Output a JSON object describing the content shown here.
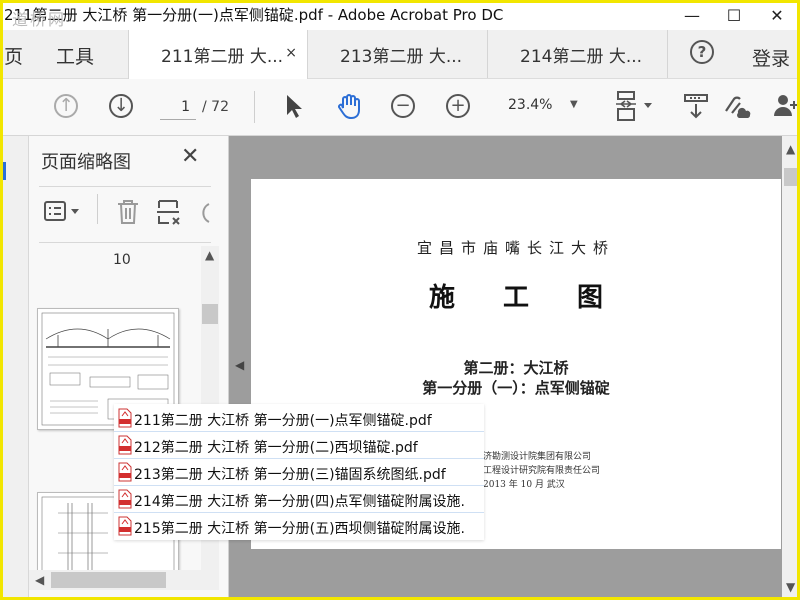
{
  "window": {
    "title": "211第二册 大江桥 第一分册(一)点军侧锚碇.pdf - Adobe Acrobat Pro DC",
    "watermark": "道桥网",
    "minimize": "—",
    "maximize": "☐",
    "close": "✕"
  },
  "menu": {
    "home": "页",
    "tools": "工具",
    "login": "登录",
    "help": "?"
  },
  "tabs": [
    {
      "label": "211第二册 大...",
      "active": true,
      "close": "×"
    },
    {
      "label": "213第二册 大...",
      "active": false
    },
    {
      "label": "214第二册 大...",
      "active": false
    }
  ],
  "toolbar": {
    "current_page": "1",
    "total_pages": "/ 72",
    "zoom": "23.4%"
  },
  "thumbnails": {
    "title": "页面缩略图",
    "close": "✕",
    "page_label": "10"
  },
  "document": {
    "subtitle": "宜昌市庙嘴长江大桥",
    "title": "施工图",
    "volume": "第二册：大江桥",
    "part": "第一分册（一）：点军侧锚碇",
    "org1": "济勘测设计院集团有限公司",
    "org2": "工程设计研究院有限责任公司",
    "date": "2013 年 10 月    武汉"
  },
  "files": [
    "211第二册 大江桥 第一分册(一)点军侧锚碇.pdf",
    "212第二册 大江桥 第一分册(二)西坝锚碇.pdf",
    "213第二册 大江桥 第一分册(三)锚固系统图纸.pdf",
    "214第二册 大江桥 第一分册(四)点军侧锚碇附属设施.",
    "215第二册 大江桥 第一分册(五)西坝侧锚碇附属设施."
  ],
  "colors": {
    "frame": "#f2e600",
    "accent": "#2d6fd6",
    "pdf_red": "#d32f2f",
    "doc_bg": "#9d9d9d"
  }
}
